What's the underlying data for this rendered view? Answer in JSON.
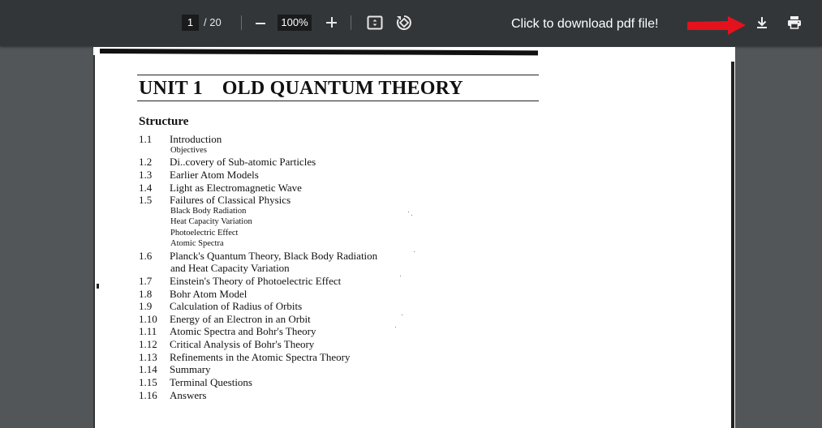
{
  "toolbar": {
    "page_number": "1",
    "page_total": "/ 20",
    "zoom": "100%",
    "download_message": "Click to download pdf file!",
    "icons": [
      "zoom-out-icon",
      "zoom-in-icon",
      "fit-page-icon",
      "rotate-icon",
      "download-icon",
      "print-icon"
    ],
    "accent_arrow_color": "#e4121c"
  },
  "document": {
    "unit_label": "UNIT 1",
    "unit_title": "OLD QUANTUM THEORY",
    "structure_heading": "Structure",
    "toc": [
      {
        "num": "1.1",
        "title": "Introduction"
      },
      {
        "sub": "Objectives"
      },
      {
        "num": "1.2",
        "title": "Di..covery of Sub-atomic Particles"
      },
      {
        "num": "1.3",
        "title": "Earlier Atom Models"
      },
      {
        "num": "1.4",
        "title": "Light as Electromagnetic Wave"
      },
      {
        "num": "1.5",
        "title": "Failures of Classical Physics"
      },
      {
        "sub": "Black Body Radiation"
      },
      {
        "sub": "Heat Capacity Variation"
      },
      {
        "sub": "Photoelectric Effect"
      },
      {
        "sub": "Atomic Spectra"
      },
      {
        "num": "1.6",
        "title": "Planck's Quantum Theory, Black Body Radiation"
      },
      {
        "cont": "and Heat Capacity Variation"
      },
      {
        "num": "1.7",
        "title": "Einstein's Theory of Photoelectric Effect"
      },
      {
        "num": "1.8",
        "title": "Bohr Atom Model"
      },
      {
        "num": "1.9",
        "title": "Calculation of Radius of Orbits"
      },
      {
        "num": "1.10",
        "title": "Energy of an Electron in an Orbit"
      },
      {
        "num": "1.11",
        "title": "Atomic Spectra and Bohr's Theory"
      },
      {
        "num": "1.12",
        "title": "Critical Analysis of Bohr's Theory"
      },
      {
        "num": "1.13",
        "title": "Refinements in the Atomic Spectra Theory"
      },
      {
        "num": "1.14",
        "title": "Summary"
      },
      {
        "num": "1.15",
        "title": "Terminal Questions"
      },
      {
        "num": "1.16",
        "title": "Answers"
      }
    ]
  }
}
